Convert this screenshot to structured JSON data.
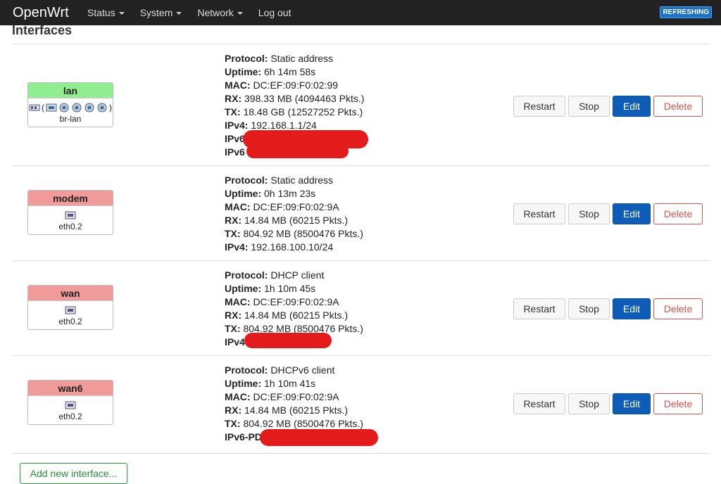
{
  "navbar": {
    "brand": "OpenWrt",
    "menu": [
      {
        "label": "Status",
        "dropdown": true
      },
      {
        "label": "System",
        "dropdown": true
      },
      {
        "label": "Network",
        "dropdown": true
      },
      {
        "label": "Log out",
        "dropdown": false
      }
    ],
    "refresh_badge": "REFRESHING"
  },
  "page_title": "Interfaces",
  "interfaces": [
    {
      "name": "lan",
      "device": "br-lan",
      "status_color": "#90ee90",
      "protocol_label": "Protocol:",
      "protocol": "Static address",
      "uptime_label": "Uptime:",
      "uptime": "6h 14m 58s",
      "mac_label": "MAC:",
      "mac": "DC:EF:09:F0:02:99",
      "rx_label": "RX:",
      "rx": "398.33 MB (4094463 Pkts.)",
      "tx_label": "TX:",
      "tx": "18.48 GB (12527252 Pkts.)",
      "ipv4_label": "IPv4:",
      "ipv4": "192.168.1.1/24",
      "ipv6_label": "IPv6",
      "ipv6b_label": "IPv6"
    },
    {
      "name": "modem",
      "device": "eth0.2",
      "status_color": "#f09a9a",
      "protocol_label": "Protocol:",
      "protocol": "Static address",
      "uptime_label": "Uptime:",
      "uptime": "0h 13m 23s",
      "mac_label": "MAC:",
      "mac": "DC:EF:09:F0:02:9A",
      "rx_label": "RX:",
      "rx": "14.84 MB (60215 Pkts.)",
      "tx_label": "TX:",
      "tx": "804.92 MB (8500476 Pkts.)",
      "ipv4_label": "IPv4:",
      "ipv4": "192.168.100.10/24"
    },
    {
      "name": "wan",
      "device": "eth0.2",
      "status_color": "#f09a9a",
      "protocol_label": "Protocol:",
      "protocol": "DHCP client",
      "uptime_label": "Uptime:",
      "uptime": "1h 10m 45s",
      "mac_label": "MAC:",
      "mac": "DC:EF:09:F0:02:9A",
      "rx_label": "RX:",
      "rx": "14.84 MB (60215 Pkts.)",
      "tx_label": "TX:",
      "tx": "804.92 MB (8500476 Pkts.)",
      "ipv4_label": "IPv4"
    },
    {
      "name": "wan6",
      "device": "eth0.2",
      "status_color": "#f09a9a",
      "protocol_label": "Protocol:",
      "protocol": "DHCPv6 client",
      "uptime_label": "Uptime:",
      "uptime": "1h 10m 41s",
      "mac_label": "MAC:",
      "mac": "DC:EF:09:F0:02:9A",
      "rx_label": "RX:",
      "rx": "14.84 MB (60215 Pkts.)",
      "tx_label": "TX:",
      "tx": "804.92 MB (8500476 Pkts.)",
      "ipv6pd_label": "IPv6-PD"
    }
  ],
  "actions": {
    "restart": "Restart",
    "stop": "Stop",
    "edit": "Edit",
    "delete": "Delete"
  },
  "add_button": "Add new interface..."
}
